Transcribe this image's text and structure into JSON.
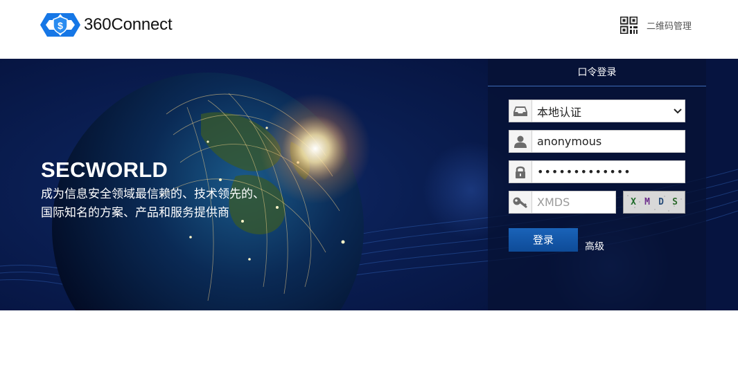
{
  "header": {
    "brand": "360Connect",
    "qr_label": "二维码管理"
  },
  "banner": {
    "title": "SECWORLD",
    "line1": "成为信息安全领域最信赖的、技术领先的、",
    "line2": "国际知名的方案、产品和服务提供商"
  },
  "login": {
    "tab_label": "口令登录",
    "auth_select": {
      "value": "本地认证"
    },
    "username": {
      "value": "anonymous"
    },
    "password": {
      "masked": "•••••••••••••"
    },
    "captcha_input": {
      "placeholder": "XMDS"
    },
    "captcha_image": {
      "chars": [
        "X",
        "M",
        "D",
        "S"
      ],
      "colors": [
        "#1f6b2a",
        "#6a2a8a",
        "#2a4e7a",
        "#2c6a2c"
      ]
    },
    "login_button": "登录",
    "advanced_link": "高级"
  },
  "colors": {
    "brand_blue": "#1677e6",
    "panel_bg": "#061234",
    "button_blue": "#1060b0"
  },
  "icons": {
    "auth": "inbox-icon",
    "username": "user-icon",
    "password": "lock-icon",
    "captcha": "key-icon",
    "qr": "qrcode-icon"
  }
}
